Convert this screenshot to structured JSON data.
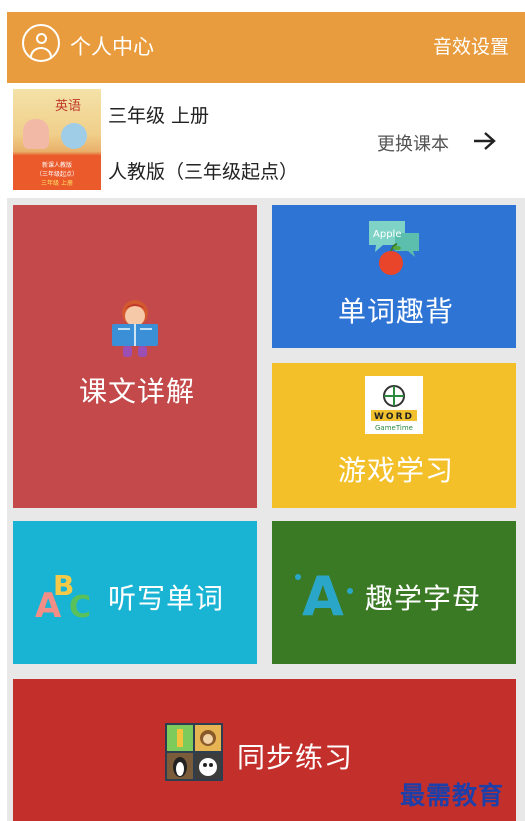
{
  "header": {
    "title": "个人中心",
    "sound_settings": "音效设置",
    "color": "#e99c3d"
  },
  "book": {
    "grade": "三年级 上册",
    "edition": "人教版（三年级起点）",
    "change_label": "更换课本",
    "cover": {
      "tag": "英语",
      "line1": "新课人教版",
      "line2": "（三年级起点）",
      "line3": "三年级 上册"
    }
  },
  "tiles": {
    "lesson": {
      "label": "课文详解",
      "color": "#c3494a",
      "icon": "reading-girl-icon"
    },
    "vocab": {
      "label": "单词趣背",
      "color": "#2e74d4",
      "icon": "apple-speech-icon",
      "bubble_text": "Apple"
    },
    "game": {
      "label": "游戏学习",
      "color": "#f3c02a",
      "icon": "word-gametime-icon",
      "icon_text_1": "WORD",
      "icon_text_2": "GameTime"
    },
    "dictation": {
      "label": "听写单词",
      "color": "#19b4d4",
      "icon": "abc-letters-icon",
      "letters": [
        "A",
        "B",
        "C"
      ]
    },
    "alphabet": {
      "label": "趣学字母",
      "color": "#3b7a25",
      "icon": "letter-a-icon",
      "letter": "A"
    },
    "sync": {
      "label": "同步练习",
      "color": "#c3302c",
      "icon": "animals-grid-icon"
    }
  },
  "watermark": "最需教育"
}
